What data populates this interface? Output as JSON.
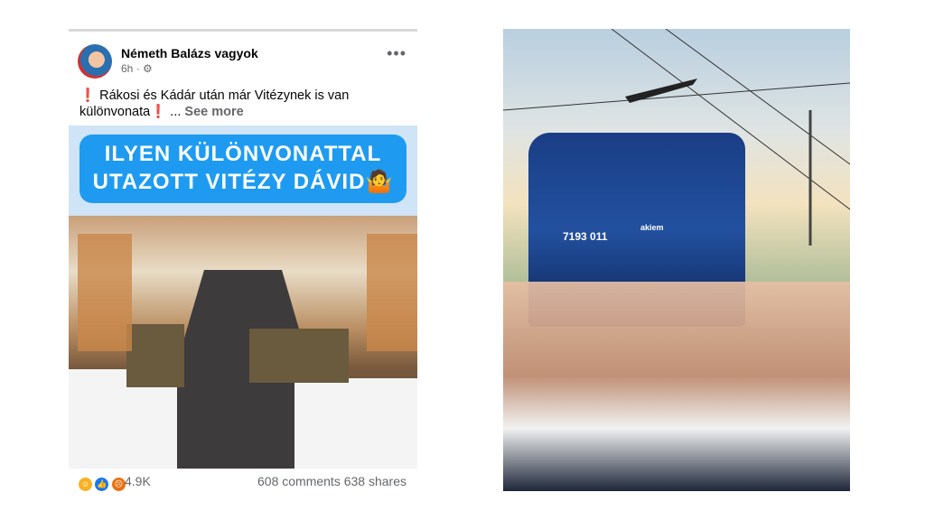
{
  "post": {
    "author": "Németh Balázs vagyok",
    "time": "6h",
    "privacy_icon": "gear-icon",
    "more_icon": "more-options-icon",
    "text_excl1": "❗",
    "text_line": "Rákosi és Kádár után már Vitézynek is van különvonata",
    "text_excl2": "❗",
    "text_ellipsis": "...",
    "see_more": "See more",
    "image_banner_line1": "ILYEN KÜLÖNVONATTAL",
    "image_banner_line2": "UTAZOTT VITÉZY DÁVID",
    "image_banner_emoji": "🤷",
    "reaction_count": "4.9K",
    "comments": "608 comments",
    "shares": "638 shares"
  },
  "photo": {
    "loco_number": "7193 011",
    "loco_brand": "akiem"
  },
  "colors": {
    "banner_blue": "#1e9bf0",
    "facebook_blue": "#1877f2",
    "excl_red": "#e0242a"
  }
}
